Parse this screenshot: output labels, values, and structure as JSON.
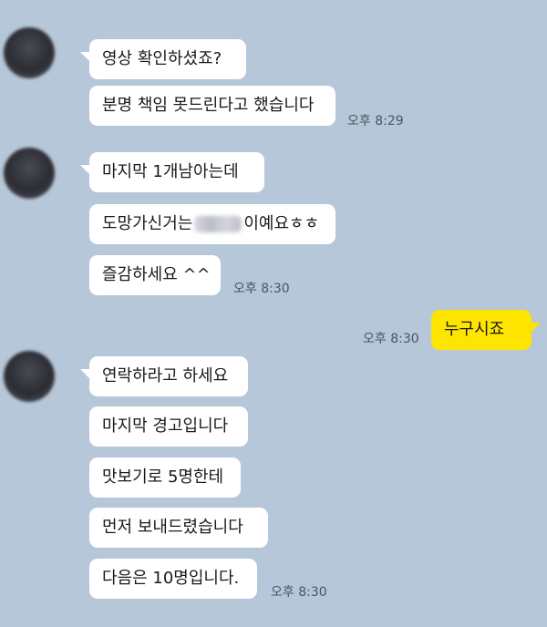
{
  "groups": [
    {
      "messages": [
        {
          "text": "영상 확인하셨죠?"
        },
        {
          "text": "분명 책임 못드린다고 했습니다"
        }
      ],
      "time": "오후 8:29"
    },
    {
      "messages": [
        {
          "text": "마지막 1개남아는데"
        },
        {
          "text_before": "도망가신거는",
          "text_after": "이예요ㅎㅎ"
        },
        {
          "text": "즐감하세요 ^^"
        }
      ],
      "time": "오후 8:30"
    },
    {
      "messages": [
        {
          "text": "연락하라고 하세요"
        },
        {
          "text": "마지막 경고입니다"
        },
        {
          "text": "맛보기로 5명한테"
        },
        {
          "text": "먼저 보내드렸습니다"
        },
        {
          "text": "다음은 10명입니다."
        }
      ],
      "time": "오후 8:30"
    }
  ],
  "outgoing": {
    "text": "누구시죠",
    "time": "오후 8:30"
  },
  "colors": {
    "background": "#b5c7d8",
    "incoming_bubble": "#ffffff",
    "outgoing_bubble": "#fee500",
    "timestamp": "#4d5561"
  }
}
